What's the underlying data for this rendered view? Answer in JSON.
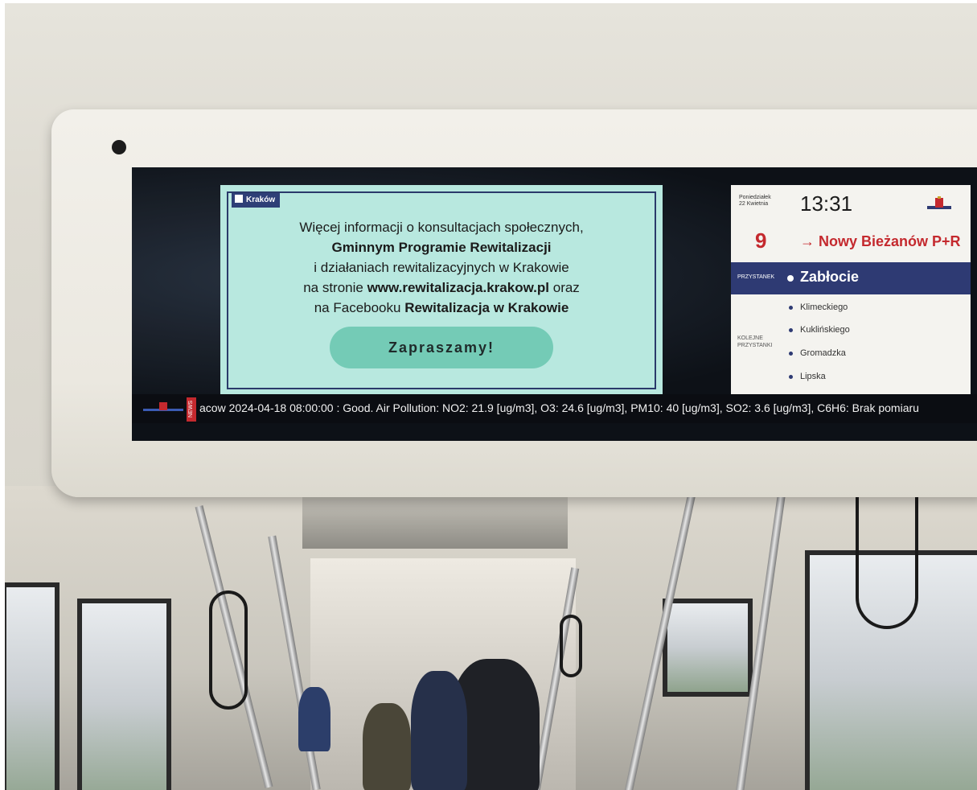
{
  "ad": {
    "tag": "Kraków",
    "line1": "Więcej informacji o konsultacjach społecznych,",
    "line2": "Gminnym Programie Rewitalizacji",
    "line3": "i działaniach rewitalizacyjnych w Krakowie",
    "line4_prefix": "na stronie ",
    "line4_bold": "www.rewitalizacja.krakow.pl",
    "line4_suffix": " oraz",
    "line5_prefix": "na Facebooku ",
    "line5_bold": "Rewitalizacja w Krakowie",
    "button": "Zapraszamy!"
  },
  "info": {
    "day": "Poniedziałek",
    "date": "22 Kwietnia",
    "time": "13:31",
    "line_number": "9",
    "destination": "→ Nowy Bieżanów P+R",
    "current_stop_label": "PRZYSTANEK",
    "current_stop": "Zabłocie",
    "next_stops_label_1": "KOLEJNE",
    "next_stops_label_2": "PRZYSTANKI",
    "next_stops": [
      "Klimeckiego",
      "Kuklińskiego",
      "Gromadzka",
      "Lipska"
    ]
  },
  "ticker": {
    "badge": "NEWS",
    "text": "acow  2024-04-18 08:00:00 :  Good.   Air Pollution: NO2: 21.9 [ug/m3], O3: 24.6 [ug/m3], PM10: 40 [ug/m3], SO2: 3.6 [ug/m3], C6H6: Brak pomiaru"
  },
  "colors": {
    "ad_background": "#b8e8df",
    "ad_button": "#74cbb6",
    "accent_navy": "#2e3a73",
    "accent_red": "#c4292e"
  }
}
